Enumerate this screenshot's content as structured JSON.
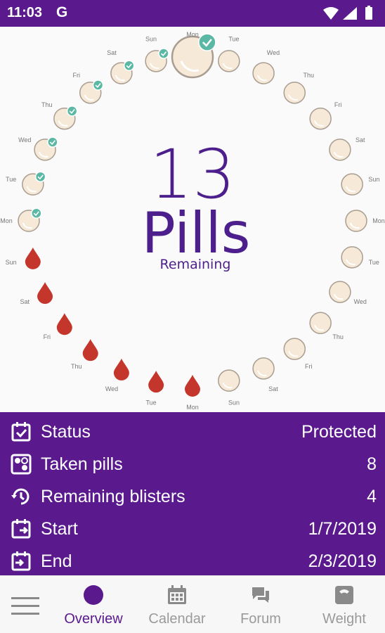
{
  "status_bar": {
    "time": "11:03",
    "g": "G"
  },
  "ring": {
    "center_number": "13",
    "center_unit": "Pills",
    "center_sub": "Remaining",
    "pills": [
      {
        "day": "Mon",
        "kind": "active",
        "taken": true
      },
      {
        "day": "Tue",
        "kind": "active",
        "taken": false
      },
      {
        "day": "Wed",
        "kind": "active",
        "taken": false
      },
      {
        "day": "Thu",
        "kind": "active",
        "taken": false
      },
      {
        "day": "Fri",
        "kind": "active",
        "taken": false
      },
      {
        "day": "Sat",
        "kind": "active",
        "taken": false
      },
      {
        "day": "Sun",
        "kind": "active",
        "taken": false
      },
      {
        "day": "Mon",
        "kind": "active",
        "taken": false
      },
      {
        "day": "Tue",
        "kind": "active",
        "taken": false
      },
      {
        "day": "Wed",
        "kind": "active",
        "taken": false
      },
      {
        "day": "Thu",
        "kind": "active",
        "taken": false
      },
      {
        "day": "Fri",
        "kind": "active",
        "taken": false
      },
      {
        "day": "Sat",
        "kind": "active",
        "taken": false
      },
      {
        "day": "Sun",
        "kind": "active",
        "taken": false
      },
      {
        "day": "Mon",
        "kind": "placebo",
        "taken": false
      },
      {
        "day": "Tue",
        "kind": "placebo",
        "taken": false
      },
      {
        "day": "Wed",
        "kind": "placebo",
        "taken": false
      },
      {
        "day": "Thu",
        "kind": "placebo",
        "taken": false
      },
      {
        "day": "Fri",
        "kind": "placebo",
        "taken": false
      },
      {
        "day": "Sat",
        "kind": "placebo",
        "taken": false
      },
      {
        "day": "Sun",
        "kind": "placebo",
        "taken": false
      },
      {
        "day": "Mon",
        "kind": "active",
        "taken": true
      },
      {
        "day": "Tue",
        "kind": "active",
        "taken": true
      },
      {
        "day": "Wed",
        "kind": "active",
        "taken": true
      },
      {
        "day": "Thu",
        "kind": "active",
        "taken": true
      },
      {
        "day": "Fri",
        "kind": "active",
        "taken": true
      },
      {
        "day": "Sat",
        "kind": "active",
        "taken": true
      },
      {
        "day": "Sun",
        "kind": "active",
        "taken": true
      }
    ]
  },
  "info": {
    "rows": [
      {
        "icon": "checkbox-icon",
        "label": "Status",
        "value": "Protected"
      },
      {
        "icon": "pills-icon",
        "label": "Taken pills",
        "value": "8"
      },
      {
        "icon": "history-icon",
        "label": "Remaining blisters",
        "value": "4"
      },
      {
        "icon": "calendar-start-icon",
        "label": "Start",
        "value": "1/7/2019"
      },
      {
        "icon": "calendar-end-icon",
        "label": "End",
        "value": "2/3/2019"
      }
    ]
  },
  "nav": {
    "items": [
      {
        "label": "Overview",
        "icon": "circle-icon",
        "active": true
      },
      {
        "label": "Calendar",
        "icon": "calendar-icon",
        "active": false
      },
      {
        "label": "Forum",
        "icon": "chat-icon",
        "active": false
      },
      {
        "label": "Weight",
        "icon": "scale-icon",
        "active": false
      }
    ]
  },
  "colors": {
    "brand": "#5a1a8e",
    "text_purple": "#4d1f8c",
    "pill_fill": "#f6e9d8",
    "pill_stroke": "#a89d90",
    "check": "#5bb8a4",
    "drop": "#c4362b"
  }
}
